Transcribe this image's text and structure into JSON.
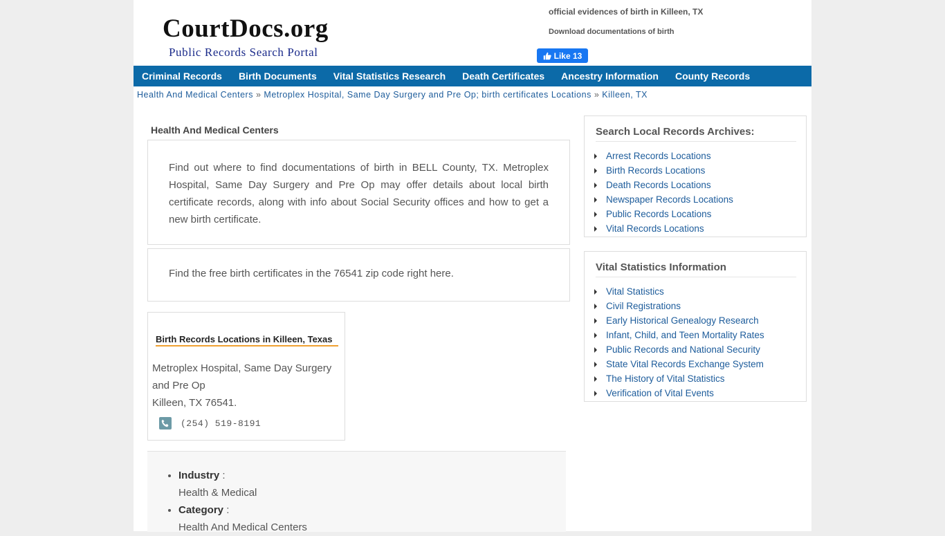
{
  "header": {
    "logo_title": "CourtDocs.org",
    "logo_subtitle": "Public Records Search Portal",
    "line1": "official evidences of birth in Killeen, TX",
    "line2": "Download documentations of birth",
    "fb_like": "Like 13"
  },
  "nav": [
    "Criminal Records",
    "Birth Documents",
    "Vital Statistics Research",
    "Death Certificates",
    "Ancestry Information",
    "County Records"
  ],
  "breadcrumb": [
    "Health And Medical Centers",
    "Metroplex Hospital, Same Day Surgery and Pre Op; birth certificates Locations",
    "Killeen, TX"
  ],
  "breadcrumb_sep": "»",
  "main": {
    "section_title": "Health And Medical Centers",
    "intro": "Find out where to find documentations of birth in BELL County, TX. Metroplex Hospital, Same Day Surgery and Pre Op may offer details about local birth certificate records, along with info about Social Security offices and how to get a new birth certificate.",
    "zip_text": "Find the free birth certificates in the 76541 zip code right here.",
    "location_box": {
      "title": "Birth Records Locations in Killeen, Texas",
      "name": "Metroplex Hospital, Same Day Surgery and Pre Op",
      "city": "Killeen, TX 76541.",
      "phone": "(254) 519-8191"
    },
    "info": [
      {
        "label": "Industry",
        "value": "Health & Medical"
      },
      {
        "label": "Category",
        "value": "Health And Medical Centers"
      }
    ]
  },
  "sidebar": {
    "search_title": "Search Local Records Archives:",
    "search_links": [
      "Arrest Records Locations",
      "Birth Records Locations",
      "Death Records Locations",
      "Newspaper Records Locations",
      "Public Records Locations",
      "Vital Records Locations"
    ],
    "vital_title": "Vital Statistics Information",
    "vital_links": [
      "Vital Statistics",
      "Civil Registrations",
      "Early Historical Genealogy Research",
      "Infant, Child, and Teen Mortality Rates",
      "Public Records and National Security",
      "State Vital Records Exchange System",
      "The History of Vital Statistics",
      "Verification of Vital Events"
    ]
  },
  "colors": {
    "nav_bg": "#0c6aa8",
    "link": "#1d5c9b",
    "accent_underline": "#f0a030",
    "facebook": "#1877f2"
  }
}
